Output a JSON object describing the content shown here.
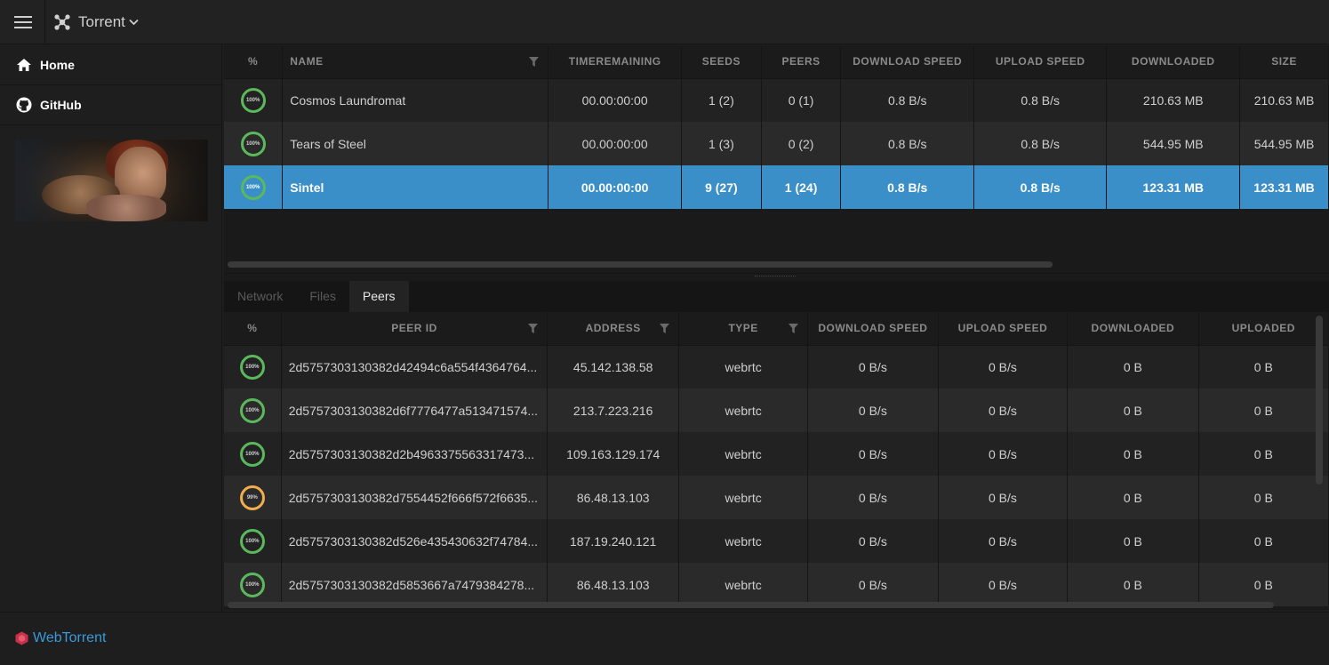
{
  "app": {
    "title": "Torrent"
  },
  "sidebar": {
    "items": [
      {
        "label": "Home"
      },
      {
        "label": "GitHub"
      }
    ]
  },
  "torrent_table": {
    "columns": [
      "%",
      "NAME",
      "TIMEREMAINING",
      "SEEDS",
      "PEERS",
      "DOWNLOAD SPEED",
      "UPLOAD SPEED",
      "DOWNLOADED",
      "SIZE"
    ],
    "rows": [
      {
        "progress": "100%",
        "name": "Cosmos Laundromat",
        "time": "00.00:00:00",
        "seeds": "1 (2)",
        "peers": "0 (1)",
        "down": "0.8 B/s",
        "up": "0.8 B/s",
        "downloaded": "210.63 MB",
        "size": "210.63 MB"
      },
      {
        "progress": "100%",
        "name": "Tears of Steel",
        "time": "00.00:00:00",
        "seeds": "1 (3)",
        "peers": "0 (2)",
        "down": "0.8 B/s",
        "up": "0.8 B/s",
        "downloaded": "544.95 MB",
        "size": "544.95 MB"
      },
      {
        "progress": "100%",
        "name": "Sintel",
        "time": "00.00:00:00",
        "seeds": "9 (27)",
        "peers": "1 (24)",
        "down": "0.8 B/s",
        "up": "0.8 B/s",
        "downloaded": "123.31 MB",
        "size": "123.31 MB"
      }
    ]
  },
  "tabs": [
    {
      "label": "Network"
    },
    {
      "label": "Files"
    },
    {
      "label": "Peers"
    }
  ],
  "peer_table": {
    "columns": [
      "%",
      "PEER ID",
      "ADDRESS",
      "TYPE",
      "DOWNLOAD SPEED",
      "UPLOAD SPEED",
      "DOWNLOADED",
      "UPLOADED"
    ],
    "rows": [
      {
        "progress": "100%",
        "peer_id": "2d5757303130382d42494c6a554f4364764...",
        "address": "45.142.138.58",
        "type": "webrtc",
        "down": "0 B/s",
        "up": "0 B/s",
        "downloaded": "0 B",
        "uploaded": "0 B"
      },
      {
        "progress": "100%",
        "peer_id": "2d5757303130382d6f7776477a513471574...",
        "address": "213.7.223.216",
        "type": "webrtc",
        "down": "0 B/s",
        "up": "0 B/s",
        "downloaded": "0 B",
        "uploaded": "0 B"
      },
      {
        "progress": "100%",
        "peer_id": "2d5757303130382d2b4963375563317473...",
        "address": "109.163.129.174",
        "type": "webrtc",
        "down": "0 B/s",
        "up": "0 B/s",
        "downloaded": "0 B",
        "uploaded": "0 B"
      },
      {
        "progress": "99%",
        "peer_id": "2d5757303130382d7554452f666f572f6635...",
        "address": "86.48.13.103",
        "type": "webrtc",
        "down": "0 B/s",
        "up": "0 B/s",
        "downloaded": "0 B",
        "uploaded": "0 B"
      },
      {
        "progress": "100%",
        "peer_id": "2d5757303130382d526e435430632f74784...",
        "address": "187.19.240.121",
        "type": "webrtc",
        "down": "0 B/s",
        "up": "0 B/s",
        "downloaded": "0 B",
        "uploaded": "0 B"
      },
      {
        "progress": "100%",
        "peer_id": "2d5757303130382d5853667a7479384278...",
        "address": "86.48.13.103",
        "type": "webrtc",
        "down": "0 B/s",
        "up": "0 B/s",
        "downloaded": "0 B",
        "uploaded": "0 B"
      }
    ]
  },
  "footer": {
    "brand": "WebTorrent"
  },
  "colors": {
    "accent": "#3a8fc9",
    "progress_complete": "#5cb85c",
    "progress_partial": "#f0ad4e",
    "brand_link": "#3a9ad9",
    "brand_icon": "#c9304a"
  }
}
